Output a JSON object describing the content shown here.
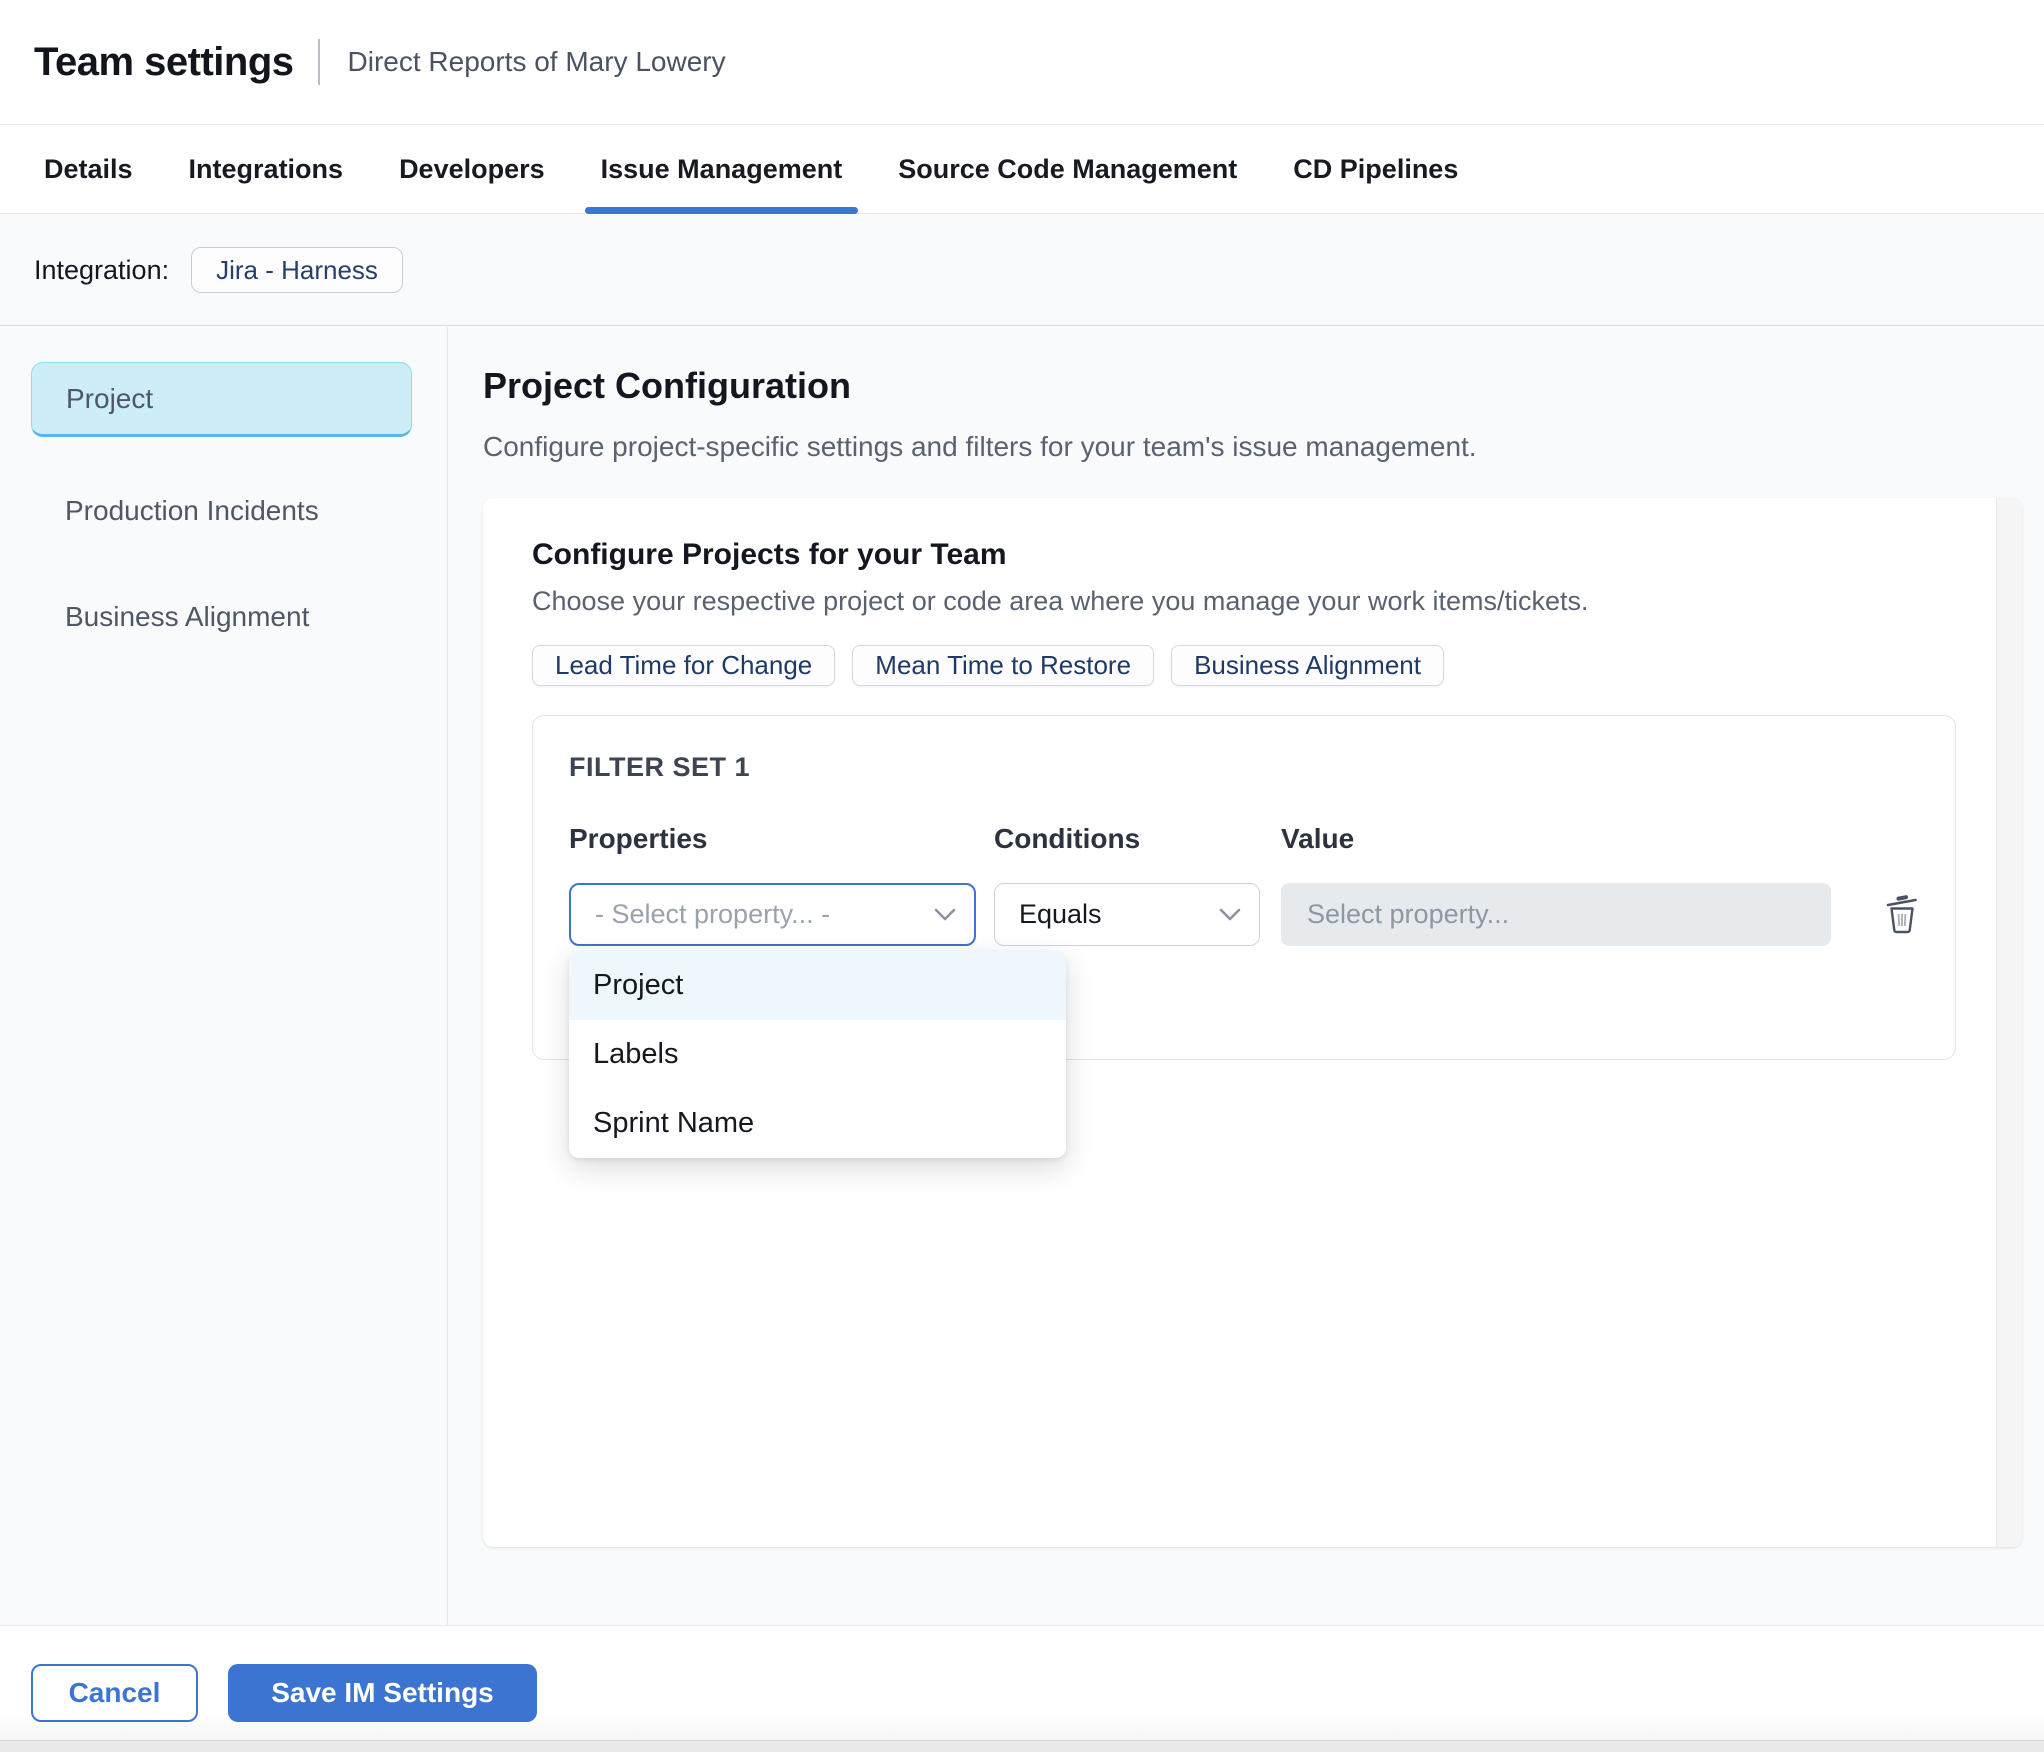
{
  "header": {
    "title": "Team settings",
    "subtitle": "Direct Reports of Mary Lowery"
  },
  "tabs": {
    "active_tab": "Issue Management",
    "items": [
      {
        "label": "Details"
      },
      {
        "label": "Integrations"
      },
      {
        "label": "Developers"
      },
      {
        "label": "Issue Management"
      },
      {
        "label": "Source Code Management"
      },
      {
        "label": "CD Pipelines"
      }
    ]
  },
  "integration": {
    "label": "Integration:",
    "chip": "Jira - Harness"
  },
  "sidebar": {
    "selected": "Project",
    "items": [
      {
        "label": "Project"
      },
      {
        "label": "Production Incidents"
      },
      {
        "label": "Business Alignment"
      }
    ]
  },
  "main": {
    "heading": "Project Configuration",
    "description": "Configure project-specific settings and filters for your team's issue management.",
    "card": {
      "title": "Configure Projects for your Team",
      "subtitle": "Choose your respective project or code area where you manage your work items/tickets.",
      "chips": [
        "Lead Time for Change",
        "Mean Time to Restore",
        "Business Alignment"
      ],
      "filter_set": {
        "title": "FILTER SET 1",
        "columns": [
          "Properties",
          "Conditions",
          "Value"
        ],
        "property_placeholder": "- Select property... -",
        "condition_value": "Equals",
        "value_placeholder": "Select property...",
        "dropdown": {
          "highlighted_option": "Project",
          "options": [
            "Project",
            "Labels",
            "Sprint Name"
          ]
        }
      }
    }
  },
  "footer": {
    "cancel_label": "Cancel",
    "save_label": "Save IM Settings"
  },
  "colors": {
    "accent_blue": "#3b74d1",
    "selected_item_bg": "#cdeef9",
    "selected_item_border": "#57b7e8",
    "dropdown_highlight": "#edf7fc",
    "content_bg": "#f8fafc"
  }
}
